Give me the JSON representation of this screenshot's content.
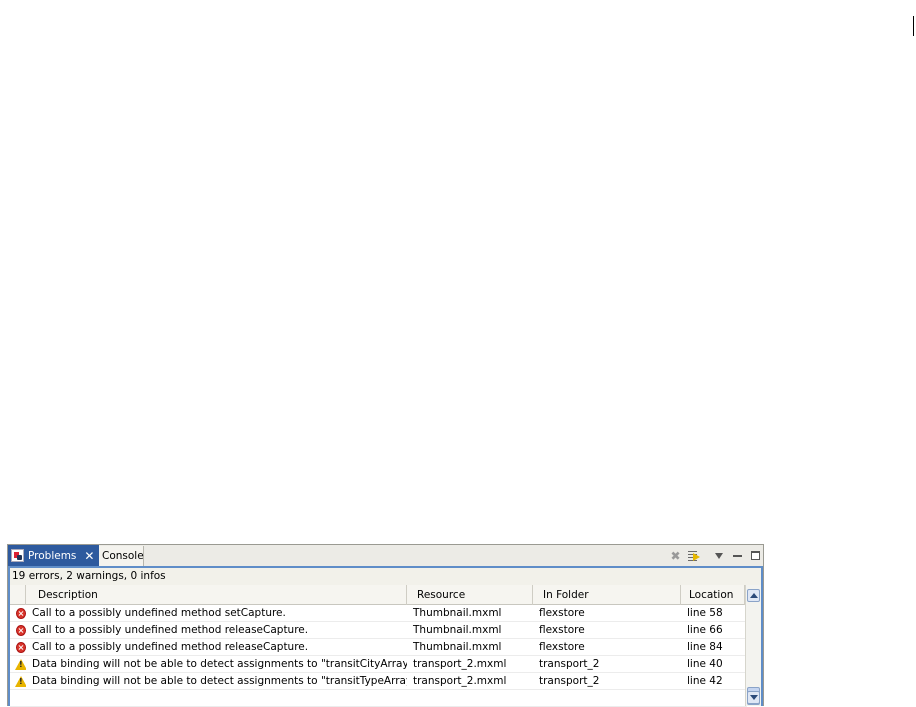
{
  "problems_view": {
    "tabs": [
      {
        "label": "Problems",
        "active": true
      },
      {
        "label": "Console",
        "active": false
      }
    ],
    "toolbar": {
      "delete_icon": "delete-x-icon",
      "filter_icon": "filter-icon",
      "menu_icon": "view-menu-icon",
      "minimize_icon": "minimize-icon",
      "maximize_icon": "maximize-icon"
    },
    "summary": "19 errors, 2 warnings, 0 infos",
    "columns": [
      "Description",
      "Resource",
      "In Folder",
      "Location"
    ],
    "rows": [
      {
        "severity": "error",
        "description": "Call to a possibly undefined method setCapture.",
        "resource": "Thumbnail.mxml",
        "folder": "flexstore",
        "location": "line 58"
      },
      {
        "severity": "error",
        "description": "Call to a possibly undefined method releaseCapture.",
        "resource": "Thumbnail.mxml",
        "folder": "flexstore",
        "location": "line 66"
      },
      {
        "severity": "error",
        "description": "Call to a possibly undefined method releaseCapture.",
        "resource": "Thumbnail.mxml",
        "folder": "flexstore",
        "location": "line 84"
      },
      {
        "severity": "warning",
        "description": "Data binding will not be able to detect assignments to \"transitCityArray\".",
        "resource": "transport_2.mxml",
        "folder": "transport_2",
        "location": "line 40"
      },
      {
        "severity": "warning",
        "description": "Data binding will not be able to detect assignments to \"transitTypeArray\".",
        "resource": "transport_2.mxml",
        "folder": "transport_2",
        "location": "line 42"
      }
    ],
    "colors": {
      "active_tab": "#2e5a9e",
      "error": "#d9352b",
      "warning": "#e8b400",
      "focus_border": "#5f8dc8"
    }
  }
}
